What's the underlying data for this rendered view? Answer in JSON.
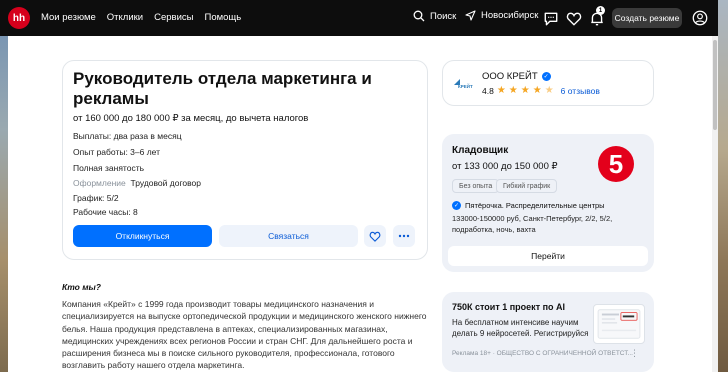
{
  "header": {
    "logo_text": "hh",
    "nav": [
      "Мои резюме",
      "Отклики",
      "Сервисы",
      "Помощь"
    ],
    "search_label": "Поиск",
    "city_label": "Новосибирск",
    "notification_count": "1",
    "create_resume_label": "Создать резюме"
  },
  "vacancy": {
    "title": "Руководитель отдела маркетинга и рекламы",
    "salary": "от 160 000 до 180 000 ₽ за месяц, до вычета налогов",
    "payouts": "Выплаты: два раза в месяц",
    "experience": "Опыт работы: 3–6 лет",
    "employment": "Полная занятость",
    "registration_label": "Оформление",
    "registration_value": "Трудовой договор",
    "schedule": "График: 5/2",
    "hours": "Рабочие часы: 8",
    "apply_label": "Откликнуться",
    "contact_label": "Связаться"
  },
  "description": {
    "heading": "Кто мы?",
    "text": "Компания «Крейт» с 1999 года производит товары медицинского назначения и специализируется на выпуске ортопедической продукции и медицинского женского нижнего белья. Наша продукция представлена в аптеках, специализированных магазинах, медицинских учреждениях всех регионов России и стран СНГ. Для дальнейшего роста и расширения бизнеса мы в поиске сильного руководителя, профессионала, готового возглавить работу нашего отдела маркетинга."
  },
  "company": {
    "logo_text": "КРЕЙТ",
    "name": "ООО КРЕЙТ",
    "rating": "4.8",
    "stars": 4.8,
    "reviews": "6 отзывов"
  },
  "recommended": {
    "title": "Кладовщик",
    "salary": "от 133 000 до 150 000 ₽",
    "chips": [
      "Без опыта",
      "Гибкий график"
    ],
    "logo_text": "5",
    "company": "Пятёрочка. Распределительные центры",
    "description": "133000-150000 руб, Санкт-Петербург, 2/2, 5/2, подработка, ночь, вахта",
    "go_label": "Перейти"
  },
  "ad": {
    "title": "750К стоит 1 проект по AI",
    "text": "На бесплатном интенсиве научим делать 9 нейросетей. Регистрируйся",
    "footer": "Реклама 18+ · ОБЩЕСТВО С ОГРАНИЧЕННОЙ ОТВЕТСТ...",
    "more": "⋮"
  },
  "colors": {
    "brand_red": "#d6001c",
    "primary_blue": "#0070ff",
    "star": "#f5a623"
  }
}
